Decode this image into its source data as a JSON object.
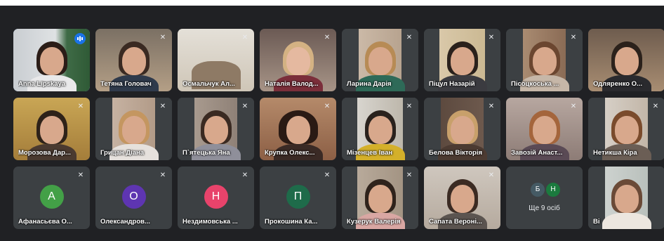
{
  "participants": [
    {
      "name": "Anna Lipskaya",
      "speaking": true
    },
    {
      "name": "Тетяна Головач"
    },
    {
      "name": "Осмальчук Ал..."
    },
    {
      "name": "Наталія Валод..."
    },
    {
      "name": "Ларина Дарія"
    },
    {
      "name": "Піцул Назарій"
    },
    {
      "name": "Пісоцкоська ..."
    },
    {
      "name": "Одляренко О..."
    },
    {
      "name": "Морозова Дар..."
    },
    {
      "name": "Грицан Діана"
    },
    {
      "name": "П`ятецька Яна"
    },
    {
      "name": "Крупка Олекс..."
    },
    {
      "name": "Мізенцев Іван"
    },
    {
      "name": "Белова Вікторія"
    },
    {
      "name": "Завозій Анаст..."
    },
    {
      "name": "Нетикша Кіра"
    },
    {
      "name": "Афанасьєва О...",
      "initial": "А",
      "color": "#43a047"
    },
    {
      "name": "Олександров...",
      "initial": "О",
      "color": "#5e35b1"
    },
    {
      "name": "Нездимовська ...",
      "initial": "Н",
      "color": "#e8436b"
    },
    {
      "name": "Прокошина Ка...",
      "initial": "П",
      "color": "#1e6b4a"
    },
    {
      "name": "Кузерук Валерія"
    },
    {
      "name": "Сапата Вероні..."
    },
    {
      "name": "Ві"
    }
  ],
  "more": {
    "label": "Ще 9 осіб",
    "avatars": [
      {
        "initial": "Б",
        "color": "#455a64"
      },
      {
        "initial": "Н",
        "color": "#1b7a3e"
      }
    ]
  }
}
